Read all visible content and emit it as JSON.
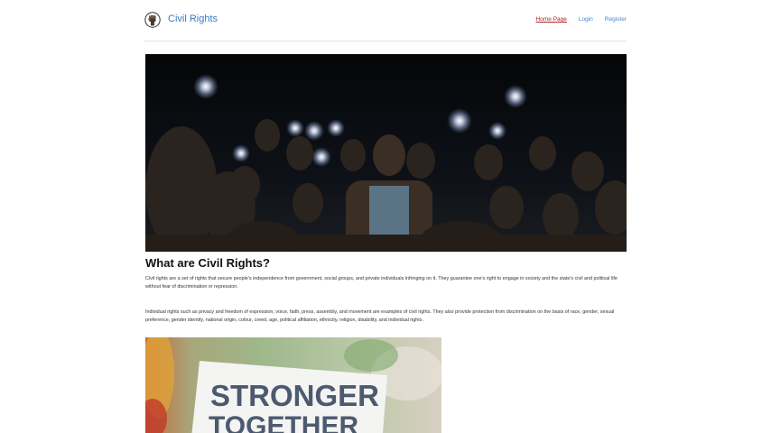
{
  "header": {
    "brand": "Civil Rights",
    "nav": {
      "home": "Home Page",
      "login": "Login",
      "register": "Register"
    }
  },
  "main": {
    "title": "What are Civil Rights?",
    "paragraph_1": "Civil rights are a set of rights that secure people's independence from government, social groups, and private individuals infringing on it. They guarantee one's right to engage in society and the state's civil and political life without fear of discrimination or repression.",
    "paragraph_2": "Individual rights such as privacy and freedom of expression, voice, faith, press, assembly, and movement are examples of civil rights. They also provide protection from discrimination on the basis of race, gender, sexual preference, gender identity, national origin, colour, creed, age, political affiliation, ethnicity, religion, disability, and individual rights.",
    "sign_text_line1": "STRONGER",
    "sign_text_line2": "TOGETHER"
  },
  "colors": {
    "brand": "#3b78c4",
    "nav_link": "#4a86c8",
    "nav_active": "#b22222"
  },
  "icons": {
    "logo": "raised-fist-icon"
  }
}
